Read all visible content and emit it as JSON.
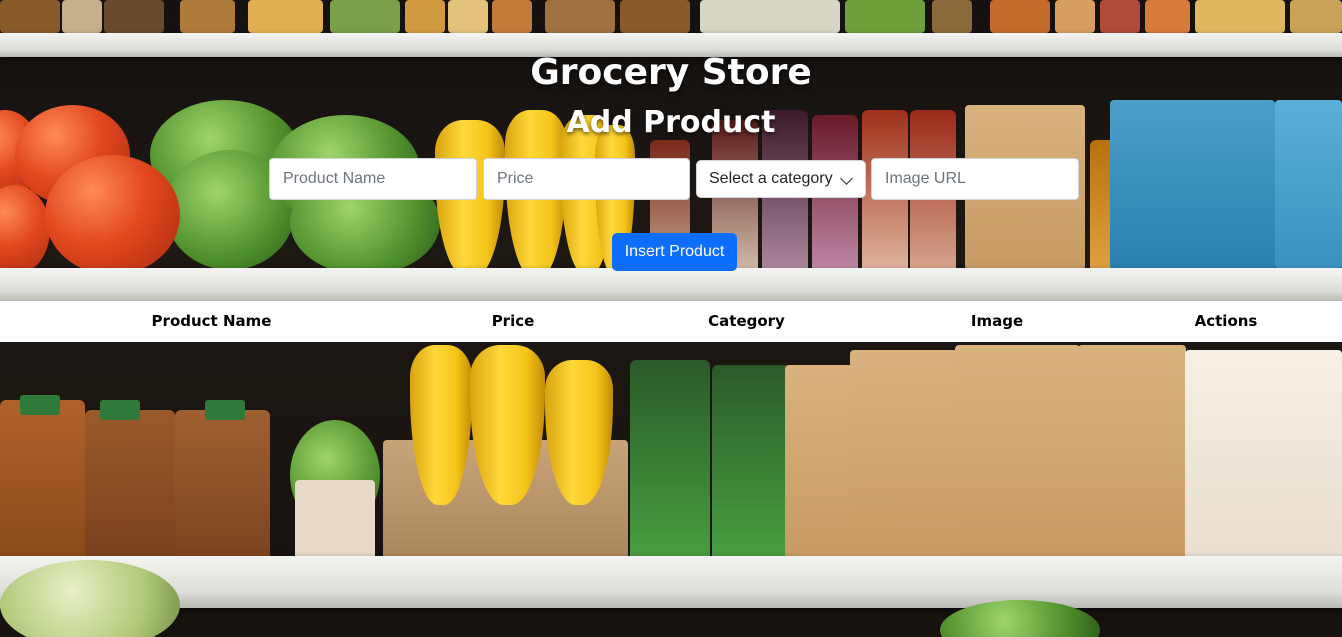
{
  "header": {
    "title": "Grocery Store",
    "subtitle": "Add Product"
  },
  "form": {
    "name_placeholder": "Product Name",
    "price_placeholder": "Price",
    "category_selected": "Select a category",
    "image_placeholder": "Image URL",
    "insert_label": "Insert Product"
  },
  "table": {
    "columns": [
      "Product Name",
      "Price",
      "Category",
      "Image",
      "Actions"
    ]
  },
  "colors": {
    "primary_button": "#0d6efd",
    "header_text": "#ffffff",
    "table_header_bg": "#ffffff"
  },
  "icons": {
    "select_arrow": "chevron-down-icon"
  }
}
